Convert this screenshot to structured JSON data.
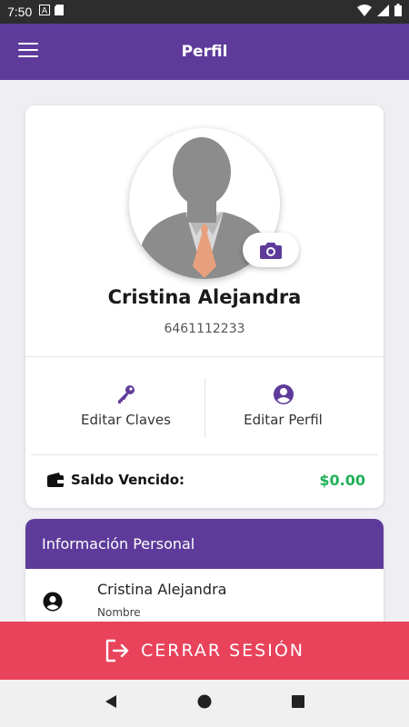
{
  "status_bar": {
    "time": "7:50"
  },
  "app_bar": {
    "title": "Perfil"
  },
  "profile": {
    "name": "Cristina Alejandra",
    "phone": "6461112233",
    "actions": [
      {
        "label": "Editar Claves",
        "icon": "key-icon"
      },
      {
        "label": "Editar Perfil",
        "icon": "account-circle-icon"
      }
    ],
    "balance_label": "Saldo Vencido:",
    "balance_value": "$0.00"
  },
  "personal_info": {
    "title": "Información Personal",
    "rows": [
      {
        "value": "Cristina Alejandra",
        "field": "Nombre",
        "icon": "person-icon"
      }
    ]
  },
  "logout": {
    "label": "CERRAR SESIÓN"
  },
  "colors": {
    "primary": "#5e3b9a",
    "logout": "#e8435b",
    "balance": "#20b15a"
  }
}
